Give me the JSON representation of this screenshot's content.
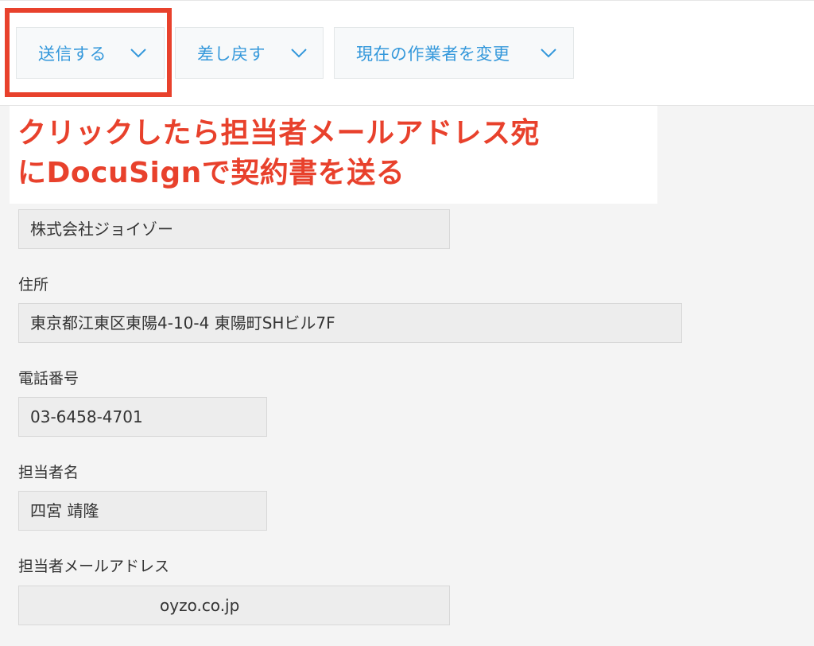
{
  "toolbar": {
    "buttons": [
      {
        "label": "送信する",
        "icon": "chevron-down-icon"
      },
      {
        "label": "差し戻す",
        "icon": "chevron-down-icon"
      },
      {
        "label": "現在の作業者を変更",
        "icon": "chevron-down-icon"
      }
    ]
  },
  "annotation": {
    "line1": "クリックしたら担当者メールアドレス宛",
    "line2": "にDocuSignで契約書を送る"
  },
  "form": {
    "company": {
      "value": "株式会社ジョイゾー"
    },
    "address": {
      "label": "住所",
      "value": "東京都江東区東陽4-10-4 東陽町SHビル7F"
    },
    "phone": {
      "label": "電話番号",
      "value": "03-6458-4701"
    },
    "contact_name": {
      "label": "担当者名",
      "value": "四宮 靖隆"
    },
    "contact_email": {
      "label": "担当者メールアドレス",
      "value": "oyzo.co.jp"
    }
  },
  "colors": {
    "accent": "#3498db",
    "annotation": "#e8412c",
    "field_bg": "#ededed"
  }
}
